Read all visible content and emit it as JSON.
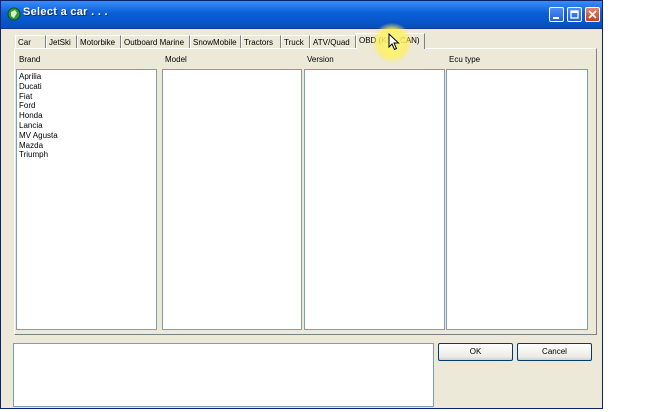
{
  "window": {
    "title": "Select a car . . ."
  },
  "tabs": [
    {
      "label": "Car"
    },
    {
      "label": "JetSki"
    },
    {
      "label": "Motorbike"
    },
    {
      "label": "Outboard Marine"
    },
    {
      "label": "SnowMobile"
    },
    {
      "label": "Tractors"
    },
    {
      "label": "Truck"
    },
    {
      "label": "ATV/Quad"
    },
    {
      "label": "OBD (K/L - CAN)",
      "active": true
    }
  ],
  "columns": {
    "brand": "Brand",
    "model": "Model",
    "version": "Version",
    "ecu_type": "Ecu type"
  },
  "brands": [
    "Aprilia",
    "Ducati",
    "Fiat",
    "Ford",
    "Honda",
    "Lancia",
    "MV Agusta",
    "Mazda",
    "Triumph"
  ],
  "buttons": {
    "ok": "OK",
    "cancel": "Cancel"
  },
  "colors": {
    "titlebar": "#0a5fd9",
    "window_bg": "#ece9d8",
    "highlight": "#fff078"
  }
}
